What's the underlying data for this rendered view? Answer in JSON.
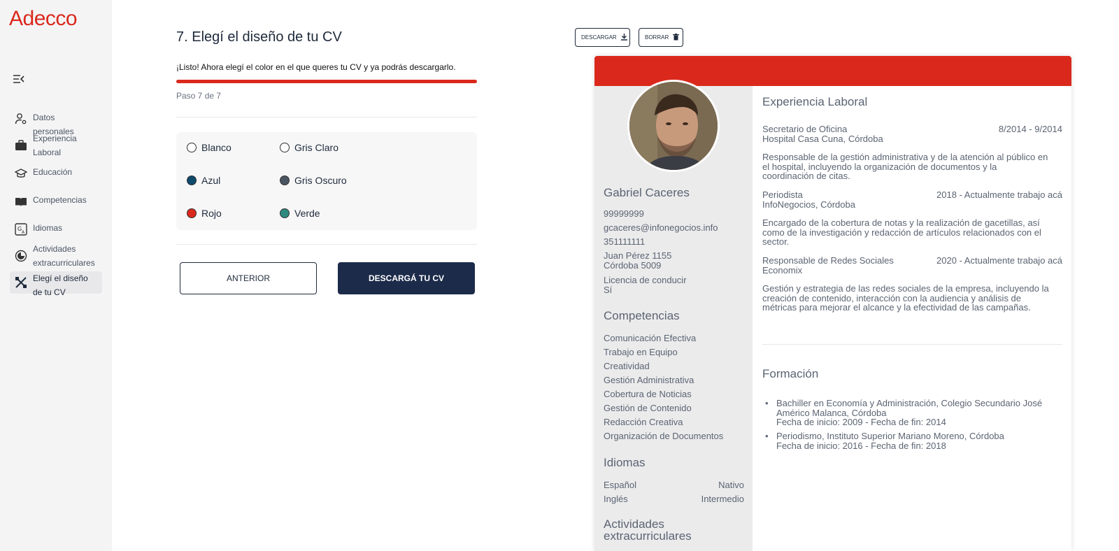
{
  "brand": {
    "logo": "Adecco",
    "accent": "#da291c",
    "navy": "#1c2b4a"
  },
  "sidebar": {
    "items": [
      {
        "label": "Datos personales",
        "icon": "user-gear-icon"
      },
      {
        "label": "Experiencia Laboral",
        "icon": "briefcase-icon"
      },
      {
        "label": "Educación",
        "icon": "graduation-cap-icon"
      },
      {
        "label": "Competencias",
        "icon": "book-open-icon"
      },
      {
        "label": "Idiomas",
        "icon": "translate-icon"
      },
      {
        "label": "Actividades extracurriculares",
        "icon": "badge-icon"
      },
      {
        "label": "Elegí el diseño de tu CV",
        "icon": "design-tools-icon",
        "active": true
      }
    ]
  },
  "form": {
    "title": "7. Elegí el diseño de tu CV",
    "subtitle": "¡Listo! Ahora elegí el color en el que queres tu CV y ya podrás descargarlo.",
    "progress": 1.0,
    "step_text": "Paso 7 de 7",
    "colors": [
      {
        "label": "Blanco",
        "color": "#ffffff"
      },
      {
        "label": "Gris Claro",
        "color": "#ffffff"
      },
      {
        "label": "Azul",
        "color": "#0d4a6b"
      },
      {
        "label": "Gris Oscuro",
        "color": "#4b5563"
      },
      {
        "label": "Rojo",
        "color": "#da291c"
      },
      {
        "label": "Verde",
        "color": "#2e8a80"
      }
    ],
    "prev_label": "ANTERIOR",
    "download_label": "DESCARGÁ TU CV"
  },
  "toolbar": {
    "download": "DESCARGAR",
    "delete": "BORRAR"
  },
  "cv": {
    "name": "Gabriel Caceres",
    "phone1": "99999999",
    "email": "gcaceres@infonegocios.info",
    "phone2": "351111111",
    "address1": "Juan Pérez 1155",
    "address2": "Córdoba 5009",
    "license_label": "Licencia de conducir",
    "license_value": "Sí",
    "skills_title": "Competencias",
    "skills": [
      "Comunicación Efectiva",
      "Trabajo en Equipo",
      "Creatividad",
      "Gestión Administrativa",
      "Cobertura de Noticias",
      "Gestión de Contenido",
      "Redacción Creativa",
      "Organización de Documentos"
    ],
    "languages_title": "Idiomas",
    "languages": [
      {
        "name": "Español",
        "level": "Nativo"
      },
      {
        "name": "Inglés",
        "level": "Intermedio"
      }
    ],
    "activities_title": "Actividades extracurriculares",
    "experience_title": "Experiencia Laboral",
    "experience": [
      {
        "role": "Secretario de Oficina",
        "period": "8/2014 - 9/2014",
        "company": "Hospital Casa Cuna, Córdoba",
        "desc": "Responsable de la gestión administrativa y de la atención al público en el hospital, incluyendo la organización de documentos y la coordinación de citas."
      },
      {
        "role": "Periodista",
        "period": "2018 - Actualmente trabajo acá",
        "company": "InfoNegocios, Córdoba",
        "desc": "Encargado de la cobertura de notas y la realización de gacetillas, así como de la investigación y redacción de artículos relacionados con el sector."
      },
      {
        "role": "Responsable de Redes Sociales",
        "period": "2020 - Actualmente trabajo acá",
        "company": "Economix",
        "desc": "Gestión y estrategia de las redes sociales de la empresa, incluyendo la creación de contenido, interacción con la audiencia y análisis de métricas para mejorar el alcance y la efectividad de las campañas."
      }
    ],
    "education_title": "Formación",
    "education": [
      {
        "title": "Bachiller en Economía y Administración, Colegio Secundario José Américo Malanca, Córdoba",
        "dates": "Fecha de inicio: 2009 - Fecha de fin: 2014"
      },
      {
        "title": "Periodismo, Instituto Superior Mariano Moreno, Córdoba",
        "dates": "Fecha de inicio: 2016 - Fecha de fin: 2018"
      }
    ]
  }
}
